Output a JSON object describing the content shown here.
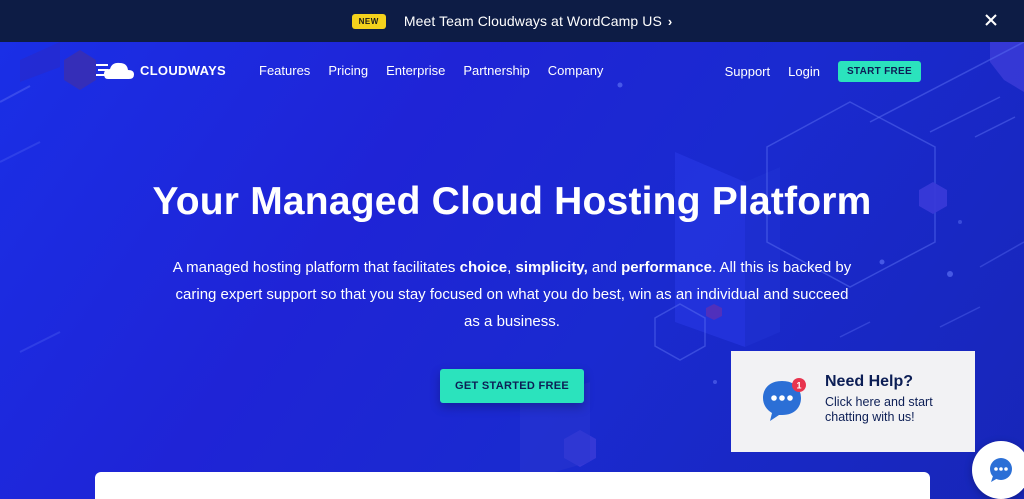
{
  "announcement": {
    "badge": "NEW",
    "message": "Meet Team Cloudways at WordCamp US",
    "chevron": "›"
  },
  "nav": {
    "logo_text": "CLOUDWAYS",
    "links": [
      "Features",
      "Pricing",
      "Enterprise",
      "Partnership",
      "Company"
    ],
    "support": "Support",
    "login": "Login",
    "start_free": "START FREE"
  },
  "hero": {
    "title": "Your Managed Cloud Hosting Platform",
    "desc_part1": "A managed hosting platform that facilitates ",
    "desc_b1": "choice",
    "desc_sep1": ", ",
    "desc_b2": "simplicity,",
    "desc_sep2": " and ",
    "desc_b3": "performance",
    "desc_part2": ". All this is backed by caring expert support so that you stay focused on what you do best, win as an individual and succeed as a business.",
    "cta": "GET STARTED FREE"
  },
  "help": {
    "title": "Need Help?",
    "line1": "Click here and start",
    "line2": "chatting with us!",
    "notification_count": "1"
  },
  "colors": {
    "topbar": "#0d1c45",
    "hero_bg": "#1a24d8",
    "accent": "#2be3bd",
    "badge": "#f4d21c",
    "chat_blue": "#2b6fd6",
    "notif_red": "#e8344e"
  }
}
